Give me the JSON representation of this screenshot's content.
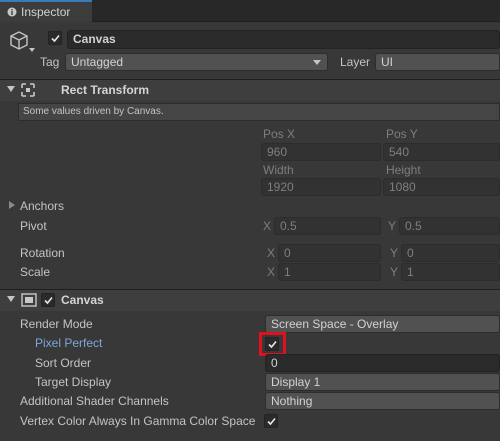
{
  "tab": {
    "label": "Inspector"
  },
  "header": {
    "object_name": "Canvas",
    "tag_label": "Tag",
    "tag_value": "Untagged",
    "layer_label": "Layer",
    "layer_value": "UI"
  },
  "rect_transform": {
    "title": "Rect Transform",
    "note": "Some values driven by Canvas.",
    "pos_x_label": "Pos X",
    "pos_y_label": "Pos Y",
    "pos_x": "960",
    "pos_y": "540",
    "width_label": "Width",
    "height_label": "Height",
    "width": "1920",
    "height": "1080",
    "anchors_label": "Anchors",
    "pivot_label": "Pivot",
    "pivot_x": "0.5",
    "pivot_y": "0.5",
    "rotation_label": "Rotation",
    "rotation_x": "0",
    "rotation_y": "0",
    "scale_label": "Scale",
    "scale_x": "1",
    "scale_y": "1",
    "x_label": "X",
    "y_label": "Y"
  },
  "canvas": {
    "title": "Canvas",
    "render_mode_label": "Render Mode",
    "render_mode_value": "Screen Space - Overlay",
    "pixel_perfect_label": "Pixel Perfect",
    "sort_order_label": "Sort Order",
    "sort_order_value": "0",
    "target_display_label": "Target Display",
    "target_display_value": "Display 1",
    "shader_channels_label": "Additional Shader Channels",
    "shader_channels_value": "Nothing",
    "vertex_color_label": "Vertex Color Always In Gamma Color Space"
  },
  "colors": {
    "highlight_box": "#e0101e",
    "accent_blue": "#7da7d9",
    "tab_underline": "#3a79bb"
  }
}
